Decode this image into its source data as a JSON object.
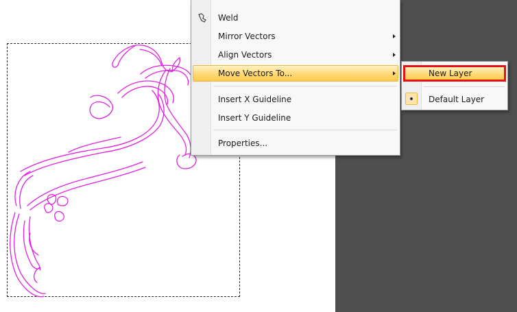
{
  "context_menu": {
    "items": [
      {
        "label": "Weld",
        "icon": "weld-icon",
        "submenu": false,
        "highlighted": false
      },
      {
        "label": "Mirror Vectors",
        "submenu": true,
        "highlighted": false
      },
      {
        "label": "Align Vectors",
        "submenu": true,
        "highlighted": false
      },
      {
        "label": "Move Vectors To...",
        "submenu": true,
        "highlighted": true
      },
      {
        "label": "Insert X Guideline",
        "submenu": false,
        "highlighted": false
      },
      {
        "label": "Insert Y Guideline",
        "submenu": false,
        "highlighted": false
      },
      {
        "label": "Properties...",
        "submenu": false,
        "highlighted": false
      }
    ]
  },
  "submenu": {
    "items": [
      {
        "label": "New Layer",
        "highlighted": true,
        "annotation": "red-outline"
      },
      {
        "label": "Default Layer",
        "checked": true,
        "icon": "radio-bullet-icon"
      }
    ]
  },
  "colors": {
    "artwork_stroke": "#e020e0",
    "highlight_outline": "#e41212",
    "dark_panel": "#4f4f4f"
  }
}
